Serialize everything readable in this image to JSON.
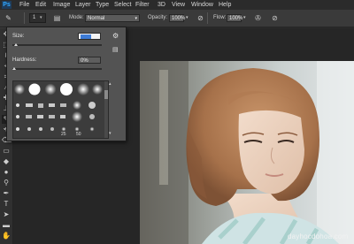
{
  "app": {
    "logo": "Ps"
  },
  "menu": [
    "File",
    "Edit",
    "Image",
    "Layer",
    "Type",
    "Select",
    "Filter",
    "3D",
    "View",
    "Window",
    "Help"
  ],
  "options": {
    "brush_size_preview": "1",
    "mode_label": "Mode:",
    "mode_value": "Normal",
    "opacity_label": "Opacity:",
    "opacity_value": "100%",
    "flow_label": "Flow:",
    "flow_value": "100%"
  },
  "brush_panel": {
    "size_label": "Size:",
    "size_value": "",
    "hardness_label": "Hardness:",
    "hardness_value": "0%",
    "size_level": 0.02,
    "hardness_level": 0.0,
    "preset_numbers": [
      "25",
      "50"
    ]
  },
  "watermark": "dayhocdohoa.com",
  "colors": {
    "accent": "#31a8ff",
    "panel": "#535353",
    "background": "#262626"
  }
}
